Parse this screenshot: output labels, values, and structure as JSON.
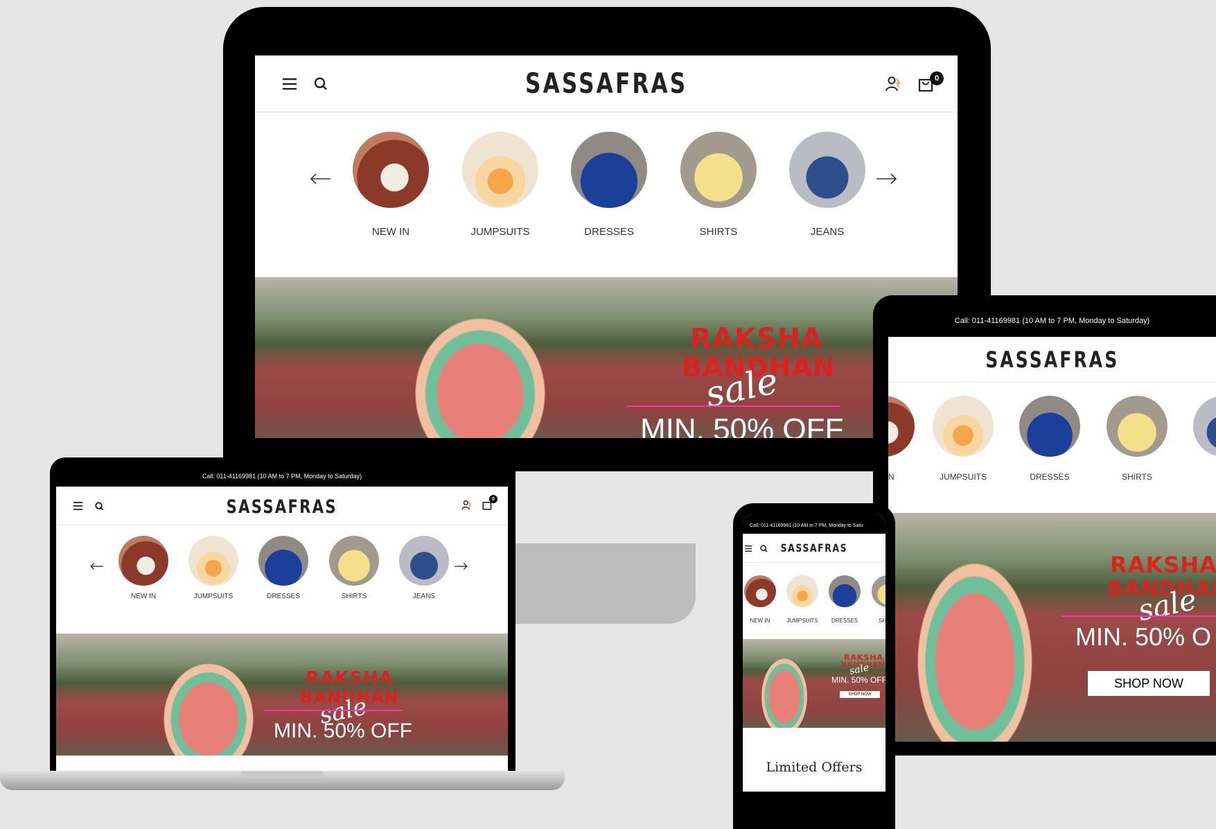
{
  "brand": "SASSAFRAS",
  "callbar": "Call: 011-41169981 (10 AM to 7 PM, Monday to Saturday)",
  "callbar_phone_cut": "Call: 011-41169981 (10 AM to 7 PM, Monday to Satu",
  "cart_count": "0",
  "categories": [
    "NEW IN",
    "JUMPSUITS",
    "DRESSES",
    "SHIRTS",
    "JEANS"
  ],
  "tablet_categories": [
    "N",
    "JUMPSUITS",
    "DRESSES",
    "SHIRTS"
  ],
  "phone_categories": [
    "NEW IN",
    "JUMPSUITS",
    "DRESSES",
    "SH"
  ],
  "banner": {
    "title_line1": "RAKSHA",
    "title_line2": "BANDHAN",
    "script": "sale",
    "offer": "MIN. 50% OFF",
    "tablet_offer": "MIN. 50% O",
    "cta": "SHOP NOW"
  },
  "phone_section_title": "Limited Offers",
  "icons": {
    "menu": "menu-icon",
    "search": "search-icon",
    "account": "account-icon",
    "cart": "cart-icon",
    "prev": "arrow-left-icon",
    "next": "arrow-right-icon"
  },
  "colors": {
    "background": "#e6e6e6",
    "device_bezel": "#000000",
    "banner_red": "#d7241f",
    "banner_wall": "#9b4a47",
    "accent_pink": "#ff2fb0"
  }
}
